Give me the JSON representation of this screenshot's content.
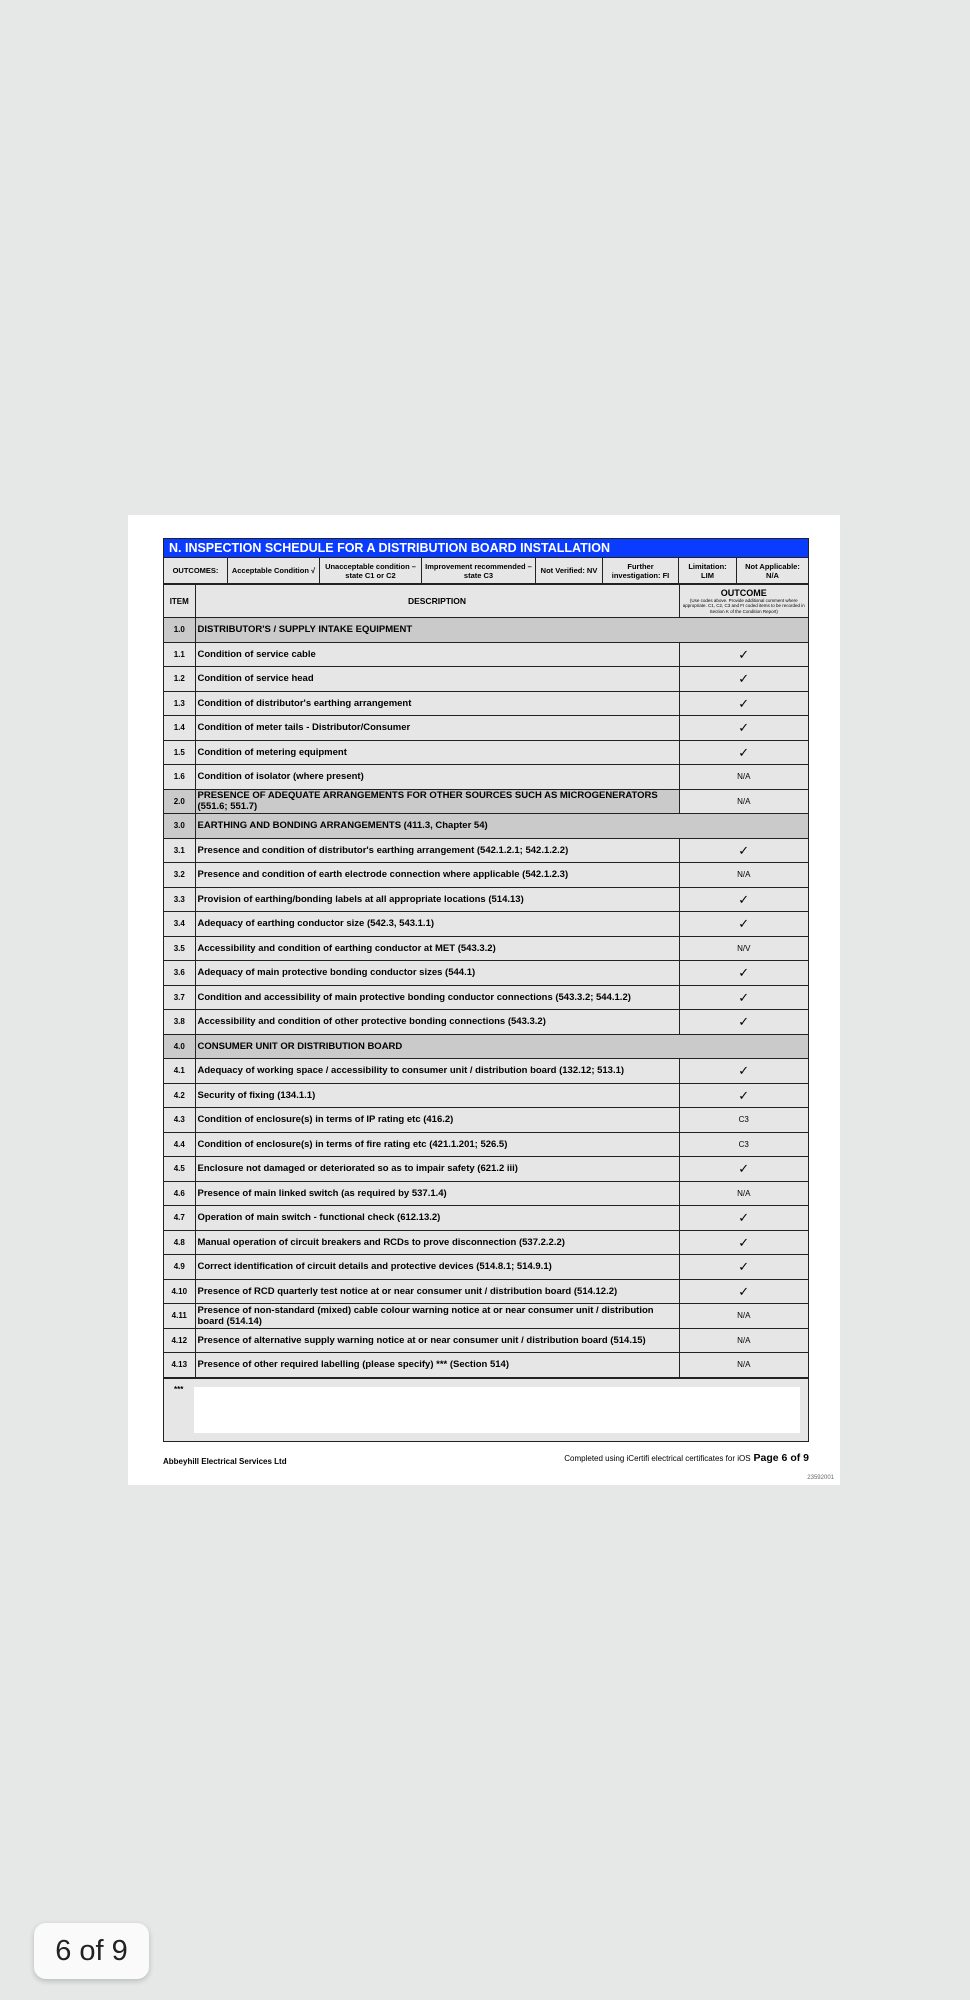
{
  "title": "N. INSPECTION SCHEDULE FOR A DISTRIBUTION BOARD INSTALLATION",
  "colors": {
    "header": "#0a3cff",
    "section_row": "#cacaca",
    "row": "#e6e6e6"
  },
  "outcomes": [
    "OUTCOMES:",
    "Acceptable Condition √",
    "Unacceptable condition – state C1 or C2",
    "Improvement recommended – state C3",
    "Not Verified: NV",
    "Further investigation: FI",
    "Limitation: LIM",
    "Not Applicable: N/A"
  ],
  "headers": {
    "item": "ITEM",
    "description": "DESCRIPTION",
    "outcome": "OUTCOME",
    "outcome_note": "(Use codes above. Provide additional comment where appropriate. C1, C2, C3 and FI coded items to be recorded in Section K of the Condition Report)"
  },
  "rows": [
    {
      "item": "1.0",
      "desc": "DISTRIBUTOR'S / SUPPLY INTAKE EQUIPMENT",
      "section": true,
      "outcome": null
    },
    {
      "item": "1.1",
      "desc": "Condition of service cable",
      "outcome": "✓"
    },
    {
      "item": "1.2",
      "desc": "Condition of service head",
      "outcome": "✓"
    },
    {
      "item": "1.3",
      "desc": "Condition of distributor's earthing arrangement",
      "outcome": "✓"
    },
    {
      "item": "1.4",
      "desc": "Condition of meter tails - Distributor/Consumer",
      "outcome": "✓"
    },
    {
      "item": "1.5",
      "desc": "Condition of metering equipment",
      "outcome": "✓"
    },
    {
      "item": "1.6",
      "desc": "Condition of isolator (where present)",
      "outcome": "N/A"
    },
    {
      "item": "2.0",
      "desc": "PRESENCE OF ADEQUATE ARRANGEMENTS FOR OTHER SOURCES SUCH AS MICROGENERATORS (551.6; 551.7)",
      "section": true,
      "outcome": "N/A"
    },
    {
      "item": "3.0",
      "desc": "EARTHING AND BONDING ARRANGEMENTS (411.3, Chapter 54)",
      "section": true,
      "outcome": null
    },
    {
      "item": "3.1",
      "desc": "Presence and condition of distributor's earthing arrangement (542.1.2.1; 542.1.2.2)",
      "outcome": "✓"
    },
    {
      "item": "3.2",
      "desc": "Presence and condition of earth electrode connection where applicable (542.1.2.3)",
      "outcome": "N/A"
    },
    {
      "item": "3.3",
      "desc": "Provision of earthing/bonding labels at all appropriate locations (514.13)",
      "outcome": "✓"
    },
    {
      "item": "3.4",
      "desc": "Adequacy of earthing conductor size (542.3, 543.1.1)",
      "outcome": "✓"
    },
    {
      "item": "3.5",
      "desc": "Accessibility and condition of earthing conductor at MET (543.3.2)",
      "outcome": "N/V"
    },
    {
      "item": "3.6",
      "desc": "Adequacy of main protective bonding conductor sizes (544.1)",
      "outcome": "✓"
    },
    {
      "item": "3.7",
      "desc": "Condition and accessibility of main protective bonding conductor connections (543.3.2; 544.1.2)",
      "outcome": "✓"
    },
    {
      "item": "3.8",
      "desc": "Accessibility and condition of other protective bonding connections (543.3.2)",
      "outcome": "✓"
    },
    {
      "item": "4.0",
      "desc": "CONSUMER UNIT OR DISTRIBUTION BOARD",
      "section": true,
      "outcome": null
    },
    {
      "item": "4.1",
      "desc": "Adequacy of working space / accessibility to consumer unit / distribution board (132.12; 513.1)",
      "outcome": "✓"
    },
    {
      "item": "4.2",
      "desc": "Security of fixing (134.1.1)",
      "outcome": "✓"
    },
    {
      "item": "4.3",
      "desc": "Condition of enclosure(s) in terms of IP rating etc (416.2)",
      "outcome": "C3"
    },
    {
      "item": "4.4",
      "desc": "Condition of enclosure(s) in terms of fire rating etc (421.1.201; 526.5)",
      "outcome": "C3"
    },
    {
      "item": "4.5",
      "desc": "Enclosure not damaged or deteriorated so as to impair safety (621.2 iii)",
      "outcome": "✓"
    },
    {
      "item": "4.6",
      "desc": "Presence of main linked switch (as required by 537.1.4)",
      "outcome": "N/A"
    },
    {
      "item": "4.7",
      "desc": "Operation of main switch - functional check (612.13.2)",
      "outcome": "✓"
    },
    {
      "item": "4.8",
      "desc": "Manual operation of circuit breakers and RCDs to prove disconnection (537.2.2.2)",
      "outcome": "✓"
    },
    {
      "item": "4.9",
      "desc": "Correct identification of circuit details and protective devices (514.8.1; 514.9.1)",
      "outcome": "✓"
    },
    {
      "item": "4.10",
      "desc": "Presence of RCD quarterly test notice at or near consumer unit / distribution board (514.12.2)",
      "outcome": "✓"
    },
    {
      "item": "4.11",
      "desc": "Presence of non-standard (mixed) cable colour warning notice at or near consumer unit / distribution board (514.14)",
      "outcome": "N/A"
    },
    {
      "item": "4.12",
      "desc": "Presence of alternative supply warning notice at or near consumer unit / distribution board (514.15)",
      "outcome": "N/A"
    },
    {
      "item": "4.13",
      "desc": "Presence of other required labelling (please specify) *** (Section 514)",
      "outcome": "N/A"
    }
  ],
  "notes_marker": "***",
  "footer": {
    "company": "Abbeyhill Electrical Services Ltd",
    "completed": "Completed using iCertifi electrical certificates for iOS",
    "page": "Page 6 of 9",
    "code": "23592001"
  },
  "page_badge": "6 of 9"
}
